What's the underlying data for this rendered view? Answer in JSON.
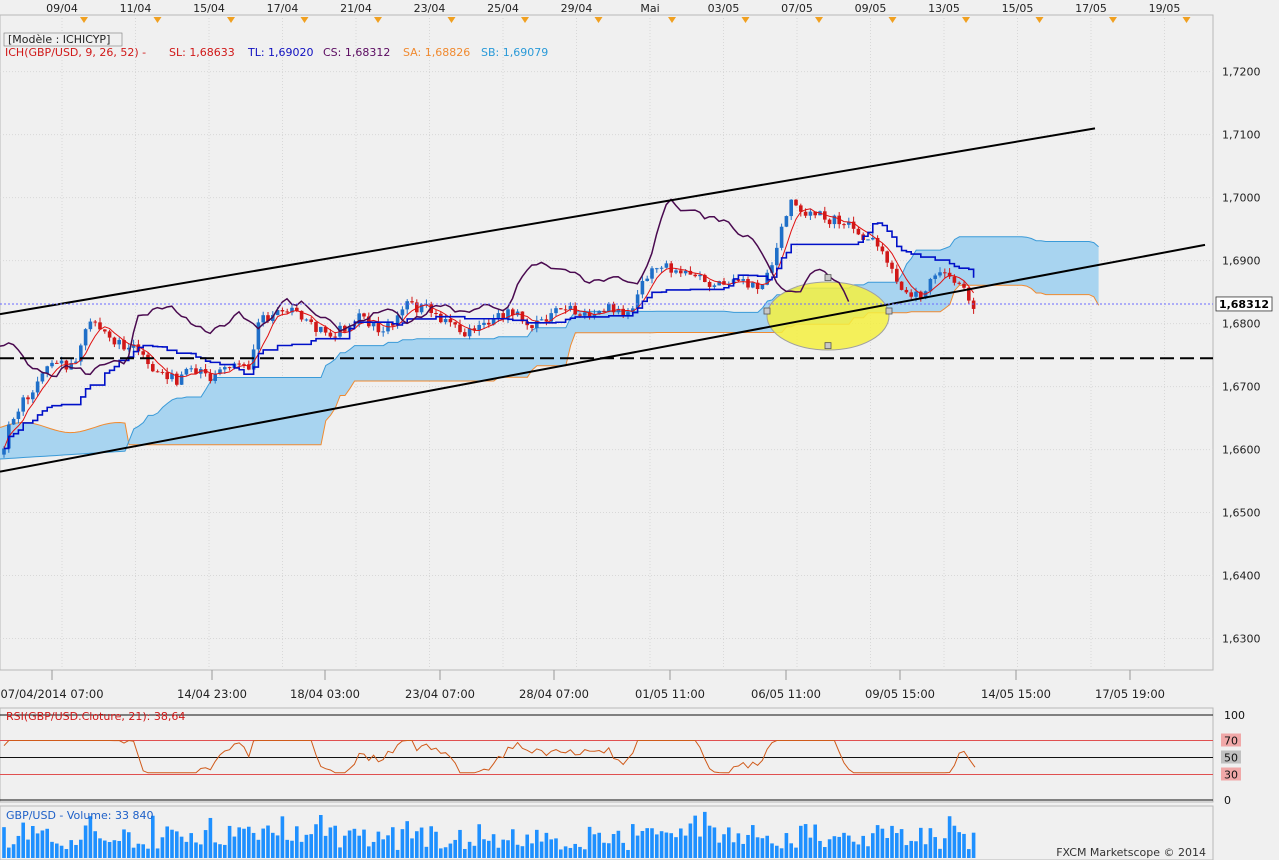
{
  "header": {
    "model_label": "[Modèle : ICHICYP]",
    "ichimoku_label": "ICH(GBP/USD, 9, 26, 52) -",
    "sl_label": "SL: 1,68633",
    "tl_label": "TL: 1,69020",
    "cs_label": "CS: 1,68312",
    "sa_label": "SA: 1,68826",
    "sb_label": "SB: 1,69079"
  },
  "top_dates": [
    "09/04",
    "11/04",
    "15/04",
    "17/04",
    "21/04",
    "23/04",
    "25/04",
    "29/04",
    "Mai",
    "03/05",
    "07/05",
    "09/05",
    "13/05",
    "15/05",
    "17/05",
    "19/05"
  ],
  "bottom_dates": [
    "07/04/2014 07:00",
    "14/04 23:00",
    "18/04 03:00",
    "23/04 07:00",
    "28/04 07:00",
    "01/05 11:00",
    "06/05 11:00",
    "09/05 15:00",
    "14/05 15:00",
    "17/05 19:00"
  ],
  "price_axis": [
    "1,7200",
    "1,7100",
    "1,7000",
    "1,6900",
    "1,6800",
    "1,6700",
    "1,6600",
    "1,6500",
    "1,6400",
    "1,6300"
  ],
  "last_price": "1,68312",
  "rsi": {
    "label": "RSI(GBP/USD.Cloture, 21): 38,64",
    "levels": [
      "100",
      "70",
      "50",
      "30",
      "0"
    ]
  },
  "volume": {
    "label": "GBP/USD - Volume: 33 840"
  },
  "footer": {
    "copyright": "FXCM Marketscope © 2014"
  },
  "colors": {
    "bull": "#1f6fc8",
    "bear": "#d01818",
    "tenkan": "#e01010",
    "kijun": "#0010c8",
    "chikou": "#4a0a50",
    "cloud": "#a8d4f0",
    "senkou_a": "#f08a30",
    "volume": "#1e90ff",
    "rsi": "#d05a1a"
  },
  "chart_data": {
    "type": "candlestick",
    "symbol": "GBP/USD",
    "ylim": [
      1.625,
      1.729
    ],
    "yticks": [
      1.72,
      1.71,
      1.7,
      1.69,
      1.68,
      1.67,
      1.66,
      1.65,
      1.64,
      1.63
    ],
    "ohlc_close_path": [
      [
        0,
        1.658
      ],
      [
        10,
        1.664
      ],
      [
        20,
        1.667
      ],
      [
        30,
        1.669
      ],
      [
        40,
        1.672
      ],
      [
        50,
        1.673
      ],
      [
        60,
        1.674
      ],
      [
        70,
        1.6725
      ],
      [
        80,
        1.676
      ],
      [
        90,
        1.681
      ],
      [
        100,
        1.6795
      ],
      [
        110,
        1.678
      ],
      [
        120,
        1.677
      ],
      [
        130,
        1.6765
      ],
      [
        140,
        1.675
      ],
      [
        150,
        1.673
      ],
      [
        160,
        1.672
      ],
      [
        170,
        1.6715
      ],
      [
        180,
        1.671
      ],
      [
        190,
        1.673
      ],
      [
        200,
        1.672
      ],
      [
        210,
        1.6715
      ],
      [
        220,
        1.6725
      ],
      [
        230,
        1.673
      ],
      [
        240,
        1.674
      ],
      [
        250,
        1.6735
      ],
      [
        260,
        1.681
      ],
      [
        270,
        1.68
      ],
      [
        280,
        1.683
      ],
      [
        290,
        1.682
      ],
      [
        300,
        1.681
      ],
      [
        310,
        1.68
      ],
      [
        320,
        1.679
      ],
      [
        330,
        1.6785
      ],
      [
        340,
        1.679
      ],
      [
        350,
        1.68
      ],
      [
        360,
        1.681
      ],
      [
        370,
        1.68
      ],
      [
        380,
        1.679
      ],
      [
        390,
        1.68
      ],
      [
        400,
        1.682
      ],
      [
        410,
        1.683
      ],
      [
        420,
        1.6825
      ],
      [
        430,
        1.682
      ],
      [
        440,
        1.681
      ],
      [
        450,
        1.68
      ],
      [
        460,
        1.679
      ],
      [
        470,
        1.6785
      ],
      [
        480,
        1.679
      ],
      [
        490,
        1.68
      ],
      [
        500,
        1.681
      ],
      [
        510,
        1.6815
      ],
      [
        520,
        1.681
      ],
      [
        530,
        1.68
      ],
      [
        540,
        1.6805
      ],
      [
        550,
        1.681
      ],
      [
        560,
        1.683
      ],
      [
        570,
        1.682
      ],
      [
        580,
        1.6815
      ],
      [
        590,
        1.681
      ],
      [
        600,
        1.682
      ],
      [
        610,
        1.6825
      ],
      [
        620,
        1.682
      ],
      [
        630,
        1.681
      ],
      [
        640,
        1.686
      ],
      [
        650,
        1.688
      ],
      [
        660,
        1.6895
      ],
      [
        670,
        1.689
      ],
      [
        680,
        1.6885
      ],
      [
        690,
        1.688
      ],
      [
        700,
        1.687
      ],
      [
        710,
        1.686
      ],
      [
        720,
        1.6865
      ],
      [
        730,
        1.687
      ],
      [
        740,
        1.6865
      ],
      [
        750,
        1.686
      ],
      [
        760,
        1.6865
      ],
      [
        770,
        1.688
      ],
      [
        780,
        1.695
      ],
      [
        790,
        1.699
      ],
      [
        800,
        1.698
      ],
      [
        810,
        1.6975
      ],
      [
        820,
        1.697
      ],
      [
        830,
        1.6965
      ],
      [
        840,
        1.696
      ],
      [
        850,
        1.6955
      ],
      [
        860,
        1.6945
      ],
      [
        870,
        1.693
      ],
      [
        880,
        1.692
      ],
      [
        890,
        1.69
      ],
      [
        900,
        1.685
      ],
      [
        910,
        1.684
      ],
      [
        920,
        1.6845
      ],
      [
        930,
        1.687
      ],
      [
        940,
        1.688
      ],
      [
        950,
        1.6875
      ],
      [
        960,
        1.686
      ],
      [
        970,
        1.6835
      ],
      [
        975,
        1.6831
      ]
    ],
    "ichimoku": {
      "tenkan_sen": 1.68633,
      "kijun_sen": 1.6902,
      "chikou_span": 1.68312,
      "senkou_a": 1.68826,
      "senkou_b": 1.69079
    },
    "channel_lines": [
      {
        "from": [
          0,
          1.6815
        ],
        "to": [
          1095,
          1.711
        ]
      },
      {
        "from": [
          0,
          1.6565
        ],
        "to": [
          1205,
          1.6925
        ]
      }
    ],
    "horizontal_line": 1.6745,
    "last_price_line": 1.68312,
    "rsi": {
      "value": 38.64,
      "levels": [
        100,
        70,
        50,
        30,
        0
      ]
    }
  }
}
